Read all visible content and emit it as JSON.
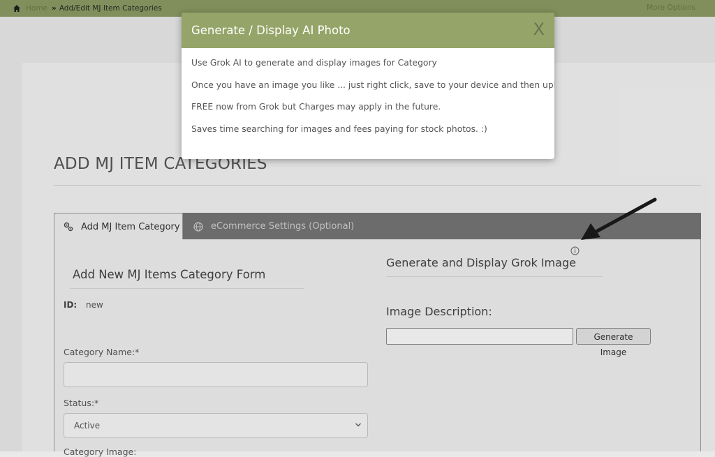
{
  "topbar": {
    "home_link": "Home",
    "breadcrumb": "Add/Edit MJ Item Categories",
    "more_options": "More Options"
  },
  "page": {
    "title": "ADD MJ ITEM CATEGORIES"
  },
  "tabs": [
    {
      "label": "Add MJ Item Category",
      "icon": "gears-icon",
      "active": true
    },
    {
      "label": "eCommerce Settings (Optional)",
      "icon": "globe-icon",
      "active": false
    }
  ],
  "form": {
    "title": "Add New MJ Items Category Form",
    "id_label": "ID:",
    "id_value": "new",
    "category_name_label": "Category Name:*",
    "category_name_value": "",
    "status_label": "Status:*",
    "status_value": "Active",
    "next_label": "Category Image:"
  },
  "grok": {
    "title": "Generate and Display Grok Image",
    "description_label": "Image Description:",
    "description_value": "",
    "generate_button": "Generate Image"
  },
  "modal": {
    "title": "Generate / Display AI Photo",
    "close_label": "X",
    "lines": [
      "Use Grok AI to generate and display images for Category",
      "Once you have an image you like ... just right click, save to your device and then upload.",
      "FREE now from Grok but Charges may apply in the future.",
      "Saves time searching for images and fees paying for stock photos. :)"
    ]
  },
  "colors": {
    "header_green": "#95a468",
    "topbar_green": "#8a9a62",
    "tabbar_gray": "#757575"
  }
}
